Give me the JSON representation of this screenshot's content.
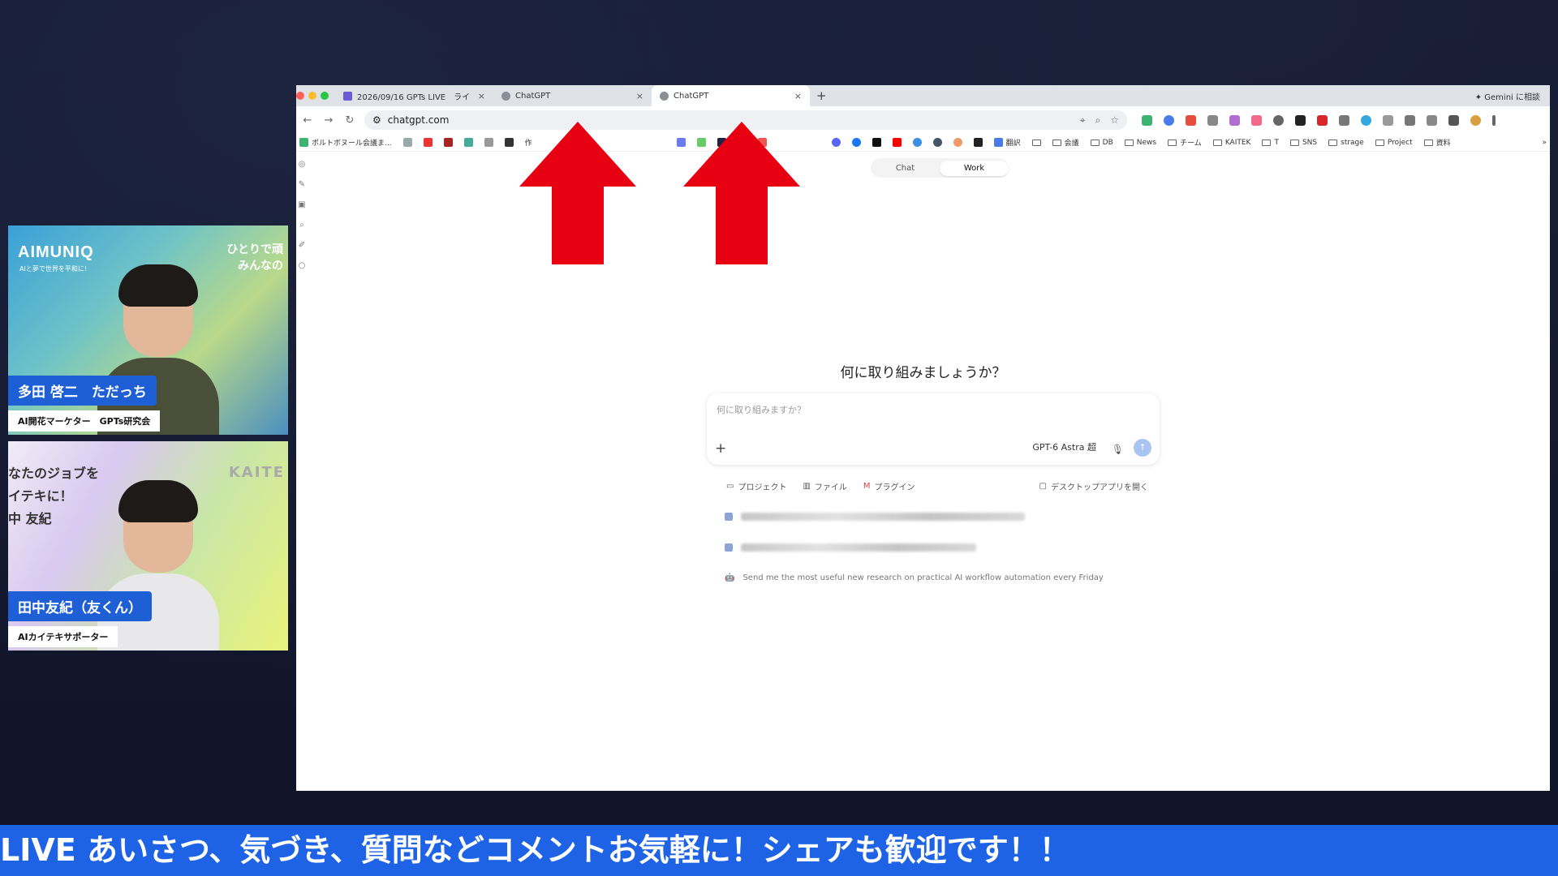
{
  "participants": [
    {
      "name": "多田 啓二　ただっち",
      "role": "AI開花マーケター　GPTs研究会",
      "logo": "AIMUNIQ",
      "logo_sub": "AIと夢で世界を平和に!",
      "tagline_1": "ひとりで頑",
      "tagline_2": "みんなの"
    },
    {
      "name": "田中友紀（友くん）",
      "role": "AIカイテキサポーター",
      "tagline_1": "なたのジョブを",
      "tagline_2": "イテキに！",
      "tagline_3": "中 友紀",
      "brand": "KAITE"
    }
  ],
  "browser": {
    "tabs": [
      {
        "title": "2026/09/16 GPTs LIVE　ライ",
        "active": false
      },
      {
        "title": "ChatGPT",
        "active": false
      },
      {
        "title": "ChatGPT",
        "active": true
      }
    ],
    "new_tab": "+",
    "close_glyph": "×",
    "gemini_button": "✦ Gemini に相談",
    "url": "chatgpt.com",
    "bookmarks": [
      {
        "label": "ポルトボヌール会議ま...",
        "type": "link"
      },
      {
        "label": "作",
        "type": "link"
      },
      {
        "label": "翻訳",
        "type": "link"
      },
      {
        "label": "会議",
        "type": "folder"
      },
      {
        "label": "DB",
        "type": "folder"
      },
      {
        "label": "News",
        "type": "folder"
      },
      {
        "label": "チーム",
        "type": "folder"
      },
      {
        "label": "KAITEK",
        "type": "folder"
      },
      {
        "label": "T",
        "type": "folder"
      },
      {
        "label": "SNS",
        "type": "folder"
      },
      {
        "label": "strage",
        "type": "folder"
      },
      {
        "label": "Project",
        "type": "folder"
      },
      {
        "label": "資料",
        "type": "folder"
      }
    ],
    "bookmarks_more": "»"
  },
  "chatgpt": {
    "modes": [
      "Chat",
      "Work"
    ],
    "active_mode": "Work",
    "heading": "何に取り組みましょうか？",
    "input_placeholder": "何に取り組みますか？",
    "model_label": "GPT-6 Astra 超",
    "chips": [
      "プロジェクト",
      "ファイル",
      "プラグイン"
    ],
    "desktop_app": "デスクトップアプリを開く",
    "suggestion": "Send me the most useful new research on practical AI workflow automation every Friday"
  },
  "ticker": "LIVE あいさつ、気づき、質問などコメントお気軽に！シェアも歓迎です！！",
  "colors": {
    "ticker_bg": "#1e63e6",
    "name_plate": "#1f5fd6",
    "arrow": "#e60012"
  }
}
